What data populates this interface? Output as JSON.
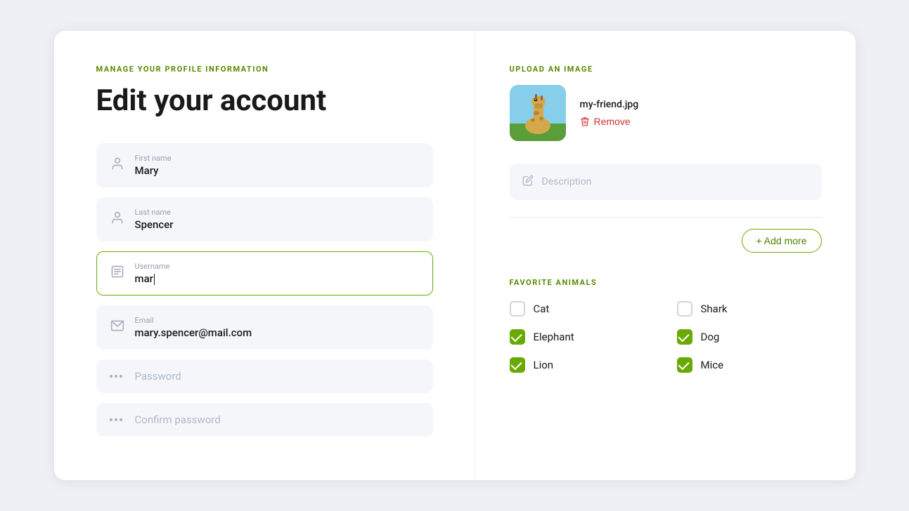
{
  "page": {
    "section_label": "MANAGE YOUR PROFILE INFORMATION",
    "title": "Edit your account"
  },
  "form": {
    "first_name": {
      "label": "First name",
      "value": "Mary"
    },
    "last_name": {
      "label": "Last name",
      "value": "Spencer"
    },
    "username": {
      "label": "Username",
      "value": "mar"
    },
    "email": {
      "label": "Email",
      "value": "mary.spencer@mail.com"
    },
    "password": {
      "label": "Password",
      "placeholder": "Password"
    },
    "confirm_password": {
      "label": "Confirm password",
      "placeholder": "Confirm password"
    }
  },
  "upload": {
    "section_label": "UPLOAD AN IMAGE",
    "filename": "my-friend.jpg",
    "remove_label": "Remove",
    "description_placeholder": "Description"
  },
  "add_more": {
    "label": "+ Add more"
  },
  "animals": {
    "section_label": "FAVORITE ANIMALS",
    "items": [
      {
        "name": "Cat",
        "checked": false
      },
      {
        "name": "Shark",
        "checked": false
      },
      {
        "name": "Elephant",
        "checked": true
      },
      {
        "name": "Dog",
        "checked": true
      },
      {
        "name": "Lion",
        "checked": true
      },
      {
        "name": "Mice",
        "checked": true
      }
    ]
  }
}
